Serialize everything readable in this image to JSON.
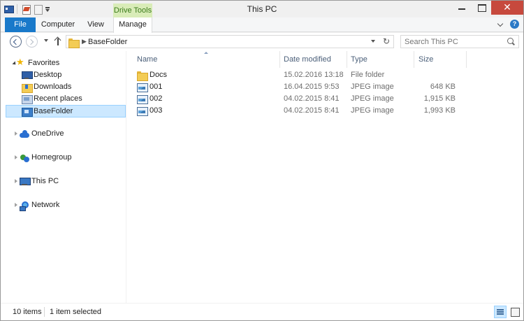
{
  "window": {
    "title": "This PC"
  },
  "ribbon": {
    "context_group": "Drive Tools",
    "tabs": [
      {
        "label": "File"
      },
      {
        "label": "Computer"
      },
      {
        "label": "View"
      },
      {
        "label": "Manage"
      }
    ]
  },
  "address": {
    "crumb": "BaseFolder",
    "search_placeholder": "Search This PC"
  },
  "nav": {
    "favorites": {
      "label": "Favorites",
      "items": [
        {
          "label": "Desktop"
        },
        {
          "label": "Downloads"
        },
        {
          "label": "Recent places"
        },
        {
          "label": "BaseFolder"
        }
      ]
    },
    "groups": [
      {
        "label": "OneDrive"
      },
      {
        "label": "Homegroup"
      },
      {
        "label": "This PC"
      },
      {
        "label": "Network"
      }
    ]
  },
  "columns": {
    "name": "Name",
    "date": "Date modified",
    "type": "Type",
    "size": "Size"
  },
  "files": [
    {
      "name": "Docs",
      "date": "15.02.2016 13:18",
      "type": "File folder",
      "size": ""
    },
    {
      "name": "001",
      "date": "16.04.2015 9:53",
      "type": "JPEG image",
      "size": "648 KB"
    },
    {
      "name": "002",
      "date": "04.02.2015 8:41",
      "type": "JPEG image",
      "size": "1,915 KB"
    },
    {
      "name": "003",
      "date": "04.02.2015 8:41",
      "type": "JPEG image",
      "size": "1,993 KB"
    }
  ],
  "status": {
    "items": "10 items",
    "selected": "1 item selected"
  },
  "colors": {
    "accent": "#1979ca",
    "selection": "#cce8ff",
    "context_tab": "#d9ecb8"
  }
}
